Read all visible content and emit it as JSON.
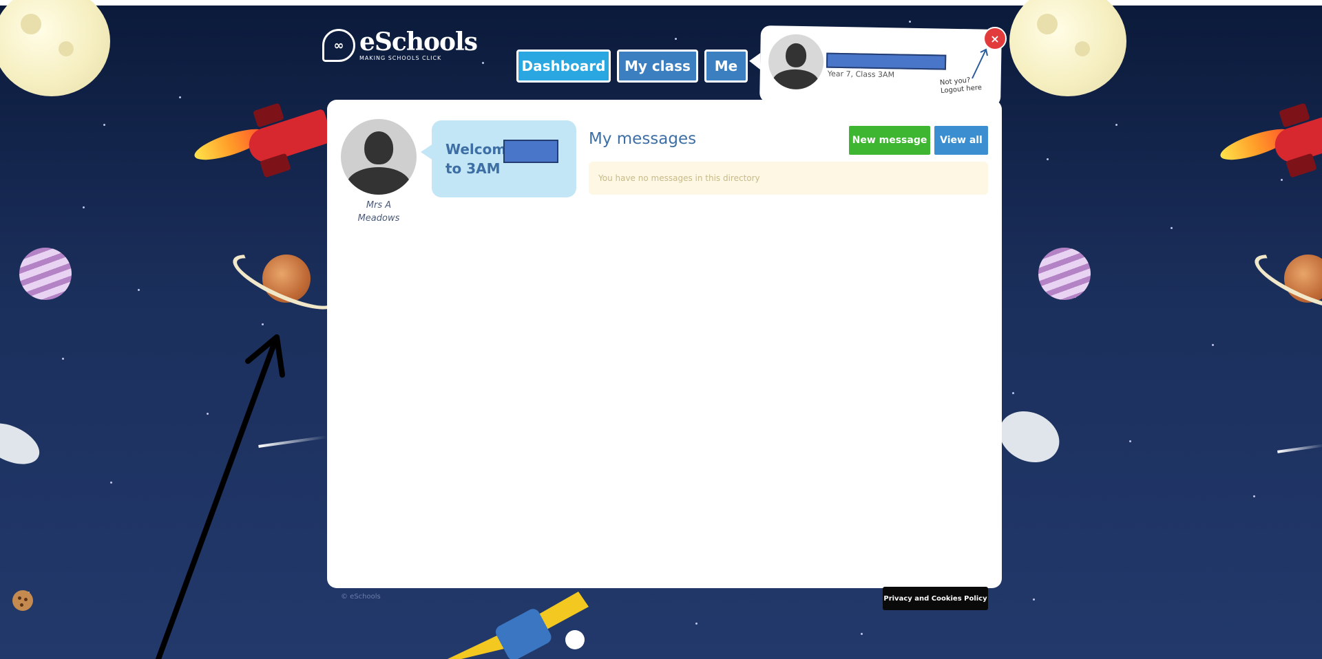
{
  "header": {
    "logo": {
      "name": "eSchools",
      "tagline": "MAKING SCHOOLS CLICK"
    },
    "nav": [
      {
        "label": "Dashboard"
      },
      {
        "label": "My class"
      },
      {
        "label": "Me"
      }
    ]
  },
  "user_popup": {
    "class_label": "Year 7, Class 3AM",
    "logout_hint": "Not you? Logout here",
    "close_symbol": "×"
  },
  "teacher": {
    "name_line1": "Mrs A",
    "name_line2": "Meadows"
  },
  "welcome": {
    "line1": "Welcome",
    "line2": "to 3AM"
  },
  "messages": {
    "title": "My messages",
    "new_button": "New message",
    "view_all_button": "View all",
    "empty_text": "You have no messages in this directory"
  },
  "footer": {
    "copyright": "© eSchools",
    "privacy_button": "Privacy and Cookies Policy"
  },
  "colors": {
    "dashboard_btn": "#2aa7e0",
    "nav_btn": "#3b7fc0",
    "new_message_btn": "#3fb632",
    "view_all_btn": "#3b8fd0",
    "close_btn": "#e23b3b",
    "redaction": "#4a76c9"
  }
}
